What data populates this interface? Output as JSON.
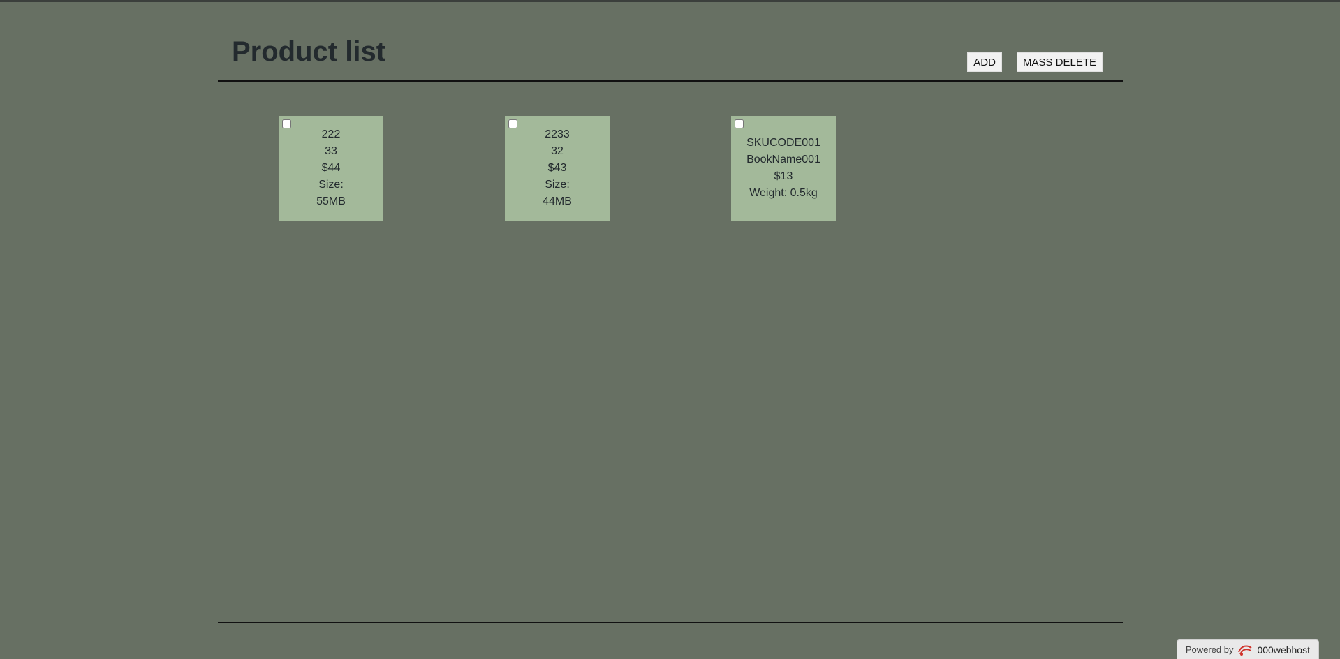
{
  "header": {
    "title": "Product list",
    "add_label": "ADD",
    "mass_delete_label": "MASS DELETE"
  },
  "products": [
    {
      "sku": "222",
      "name": "33",
      "price": "$44",
      "attr_label": "Size:",
      "attr_value": "55MB"
    },
    {
      "sku": "2233",
      "name": "32",
      "price": "$43",
      "attr_label": "Size:",
      "attr_value": "44MB"
    },
    {
      "sku": "SKUCODE001",
      "name": "BookName001",
      "price": "$13",
      "attribute": "Weight: 0.5kg"
    }
  ],
  "footer": {
    "powered_by": "Powered by",
    "brand": "000webhost",
    "logo_icon": "000webhost-logo-icon"
  },
  "colors": {
    "background": "#677063",
    "card": "#a3b99a",
    "text": "#232a2e"
  }
}
